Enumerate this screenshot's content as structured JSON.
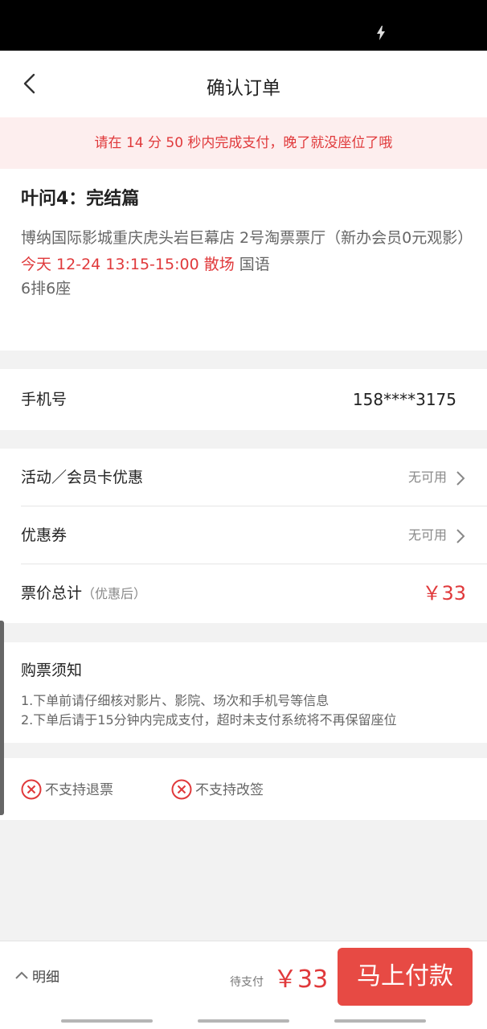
{
  "header": {
    "title": "确认订单"
  },
  "notice": {
    "text": "请在 14 分 50 秒内完成支付，晚了就没座位了哦"
  },
  "movie": {
    "title": "叶问4：完结篇",
    "cinema": "博纳国际影城重庆虎头岩巨幕店 2号淘票票厅（新办会员0元观影）",
    "showtime": "今天 12-24 13:15-15:00 散场",
    "language": "国语",
    "seat": "6排6座"
  },
  "phone": {
    "label": "手机号",
    "value": "158****3175"
  },
  "discounts": {
    "activity": {
      "label": "活动／会员卡优惠",
      "status": "无可用"
    },
    "coupon": {
      "label": "优惠券",
      "status": "无可用"
    },
    "total": {
      "label": "票价总计",
      "sub": "（优惠后）",
      "value": "￥33"
    }
  },
  "notes": {
    "title": "购票须知",
    "items": [
      "1.下单前请仔细核对影片、影院、场次和手机号等信息",
      "2.下单后请于15分钟内完成支付，超时未支付系统将不再保留座位"
    ]
  },
  "policies": {
    "refund": "不支持退票",
    "change": "不支持改签"
  },
  "footer": {
    "detail_label": "明细",
    "pending_label": "待支付",
    "amount": "￥33",
    "pay_label": "马上付款"
  },
  "colors": {
    "accent": "#e0393b",
    "pay_button": "#e74a44",
    "notice_bg": "#fdeeee"
  },
  "icons": [
    "lightning-icon",
    "back-arrow-icon",
    "chevron-right-icon",
    "circle-x-icon",
    "chevron-up-icon"
  ]
}
